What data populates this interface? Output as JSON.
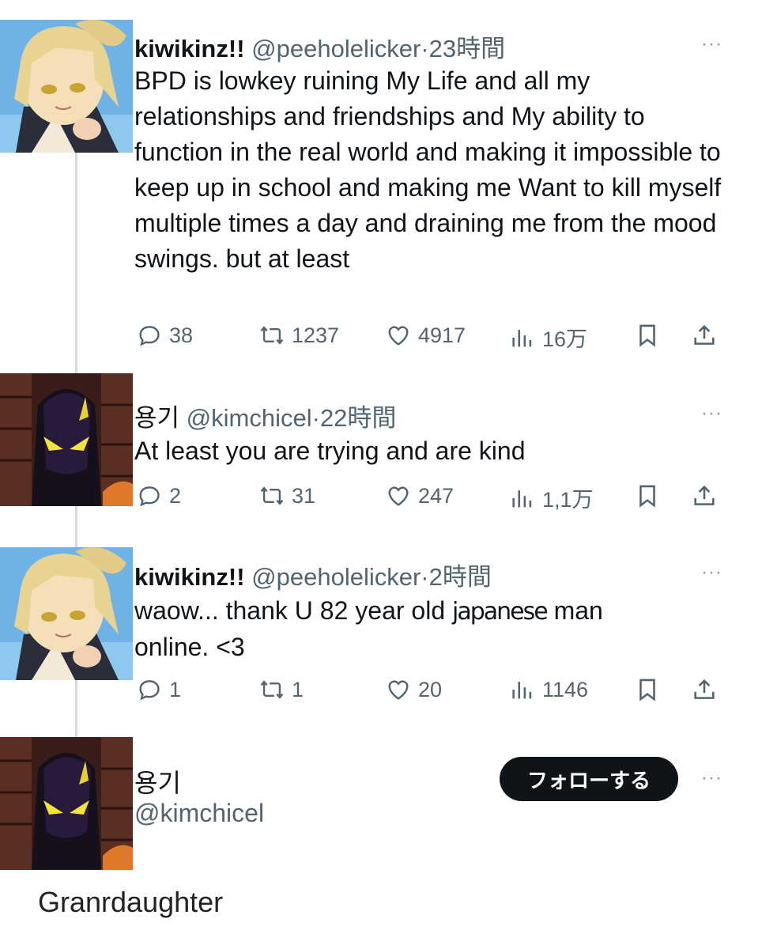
{
  "tweets": [
    {
      "name": "kiwikinz!!",
      "handle": "@peeholelicker",
      "time": "23時間",
      "text": "BPD is lowkey ruining My Life and all my relationships and friendships and My ability to function in the real world and making it impossible to keep up in school  and making me Want to kill myself multiple times a day and draining me from the mood swings. but at least",
      "replies": "38",
      "retweets": "1237",
      "likes": "4917",
      "views": "16万"
    },
    {
      "name": "용기",
      "handle": "@kimchicel",
      "time": "22時間",
      "text": "At least you are trying and are kind",
      "replies": "2",
      "retweets": "31",
      "likes": "247",
      "views": "1,1万"
    },
    {
      "name": "kiwikinz!!",
      "handle": "@peeholelicker",
      "time": "2時間",
      "text_before": "waow... thank U 82 year old",
      "text_pasted": "japanese",
      "text_after": "man online. <3",
      "replies": "1",
      "retweets": "1",
      "likes": "20",
      "views": "1146"
    }
  ],
  "profile": {
    "name": "용기",
    "handle": "@kimchicel",
    "follow_label": "フォローする"
  },
  "caption": "Granrdaughter",
  "more_label": "···",
  "separator": "·",
  "icons": {
    "reply": "reply-icon",
    "retweet": "retweet-icon",
    "like": "heart-icon",
    "views": "views-icon",
    "bookmark": "bookmark-icon",
    "share": "share-icon"
  },
  "colors": {
    "text": "#0f1419",
    "secondary": "#536471",
    "button_bg": "#0f1419",
    "thread_line": "#cfd9de"
  }
}
